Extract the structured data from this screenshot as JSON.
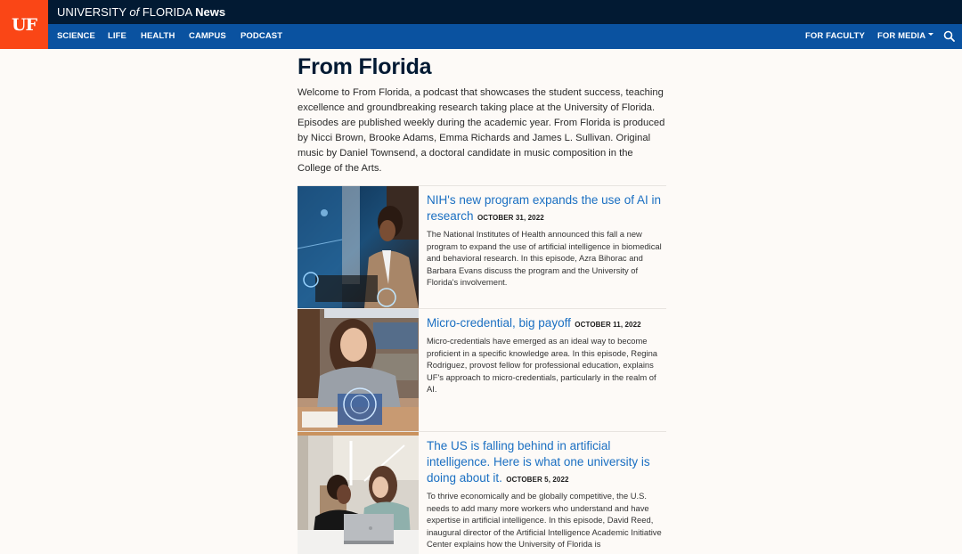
{
  "header": {
    "logo": "UF",
    "site_title_part1": "UNIVERSITY ",
    "site_title_of": "of",
    "site_title_part2": " FLORIDA ",
    "site_title_news": "News"
  },
  "nav": {
    "left": [
      "SCIENCE",
      "LIFE",
      "HEALTH",
      "CAMPUS",
      "PODCAST"
    ],
    "right": {
      "faculty": "FOR FACULTY",
      "media": "FOR MEDIA"
    },
    "search_icon": "search-icon"
  },
  "page": {
    "title": "From Florida",
    "intro": "Welcome to From Florida, a podcast that showcases the student success, teaching excellence and groundbreaking research taking place at the University of Florida. Episodes are published weekly during the academic year. From Florida is produced by Nicci Brown, Brooke Adams, Emma Richards and James L. Sullivan. Original music by Daniel Townsend, a doctoral candidate in music composition in the College of the Arts."
  },
  "episodes": [
    {
      "title": "NIH's new program expands the use of AI in research",
      "date": "OCTOBER 31, 2022",
      "description": "The National Institutes of Health announced this fall a new program to expand the use of artificial intelligence in biomedical and behavioral research. In this episode, Azra Bihorac and Barbara Evans discuss the program and the University of Florida's involvement.",
      "image": "woman-with-ai-hologram-interface"
    },
    {
      "title": "Micro-credential, big payoff",
      "date": "OCTOBER 11, 2022",
      "description": "Micro-credentials have emerged as an ideal way to become proficient in a specific knowledge area. In this episode, Regina Rodriguez, provost fellow for professional education, explains UF's approach to micro-credentials, particularly in the realm of AI.",
      "image": "student-in-library-with-tablet"
    },
    {
      "title": "The US is falling behind in artificial intelligence. Here is what one university is doing about it.",
      "date": "OCTOBER 5, 2022",
      "description": "To thrive economically and be globally competitive, the U.S. needs to add many more workers who understand and have expertise in artificial intelligence. In this episode, David Reed, inaugural director of the Artificial Intelligence Academic Initiative Center explains how the University of Florida is",
      "image": "two-students-with-laptop"
    }
  ],
  "colors": {
    "uf_orange": "#fa4616",
    "topbar_navy": "#021a33",
    "nav_blue": "#0a52a0",
    "link_blue": "#1a6fc2"
  }
}
